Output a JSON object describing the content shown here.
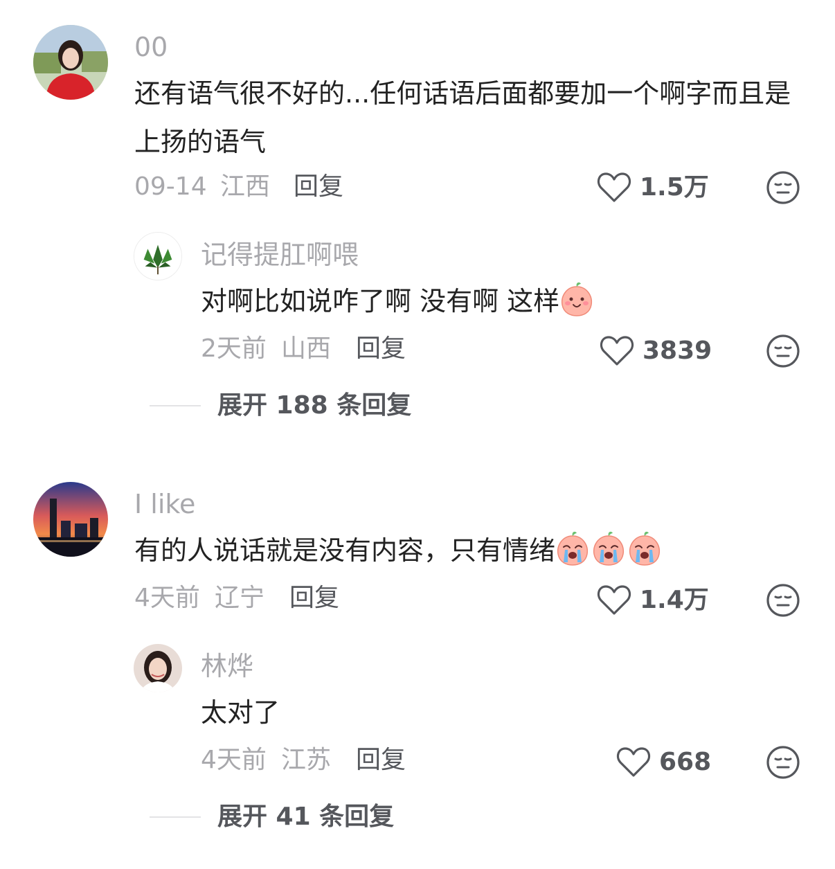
{
  "comments": [
    {
      "username": "00",
      "content": "还有语气很不好的...任何话语后面都要加一个啊字而且是上扬的语气",
      "time": "09-14",
      "location": "江西",
      "reply_label": "回复",
      "likes": "1.5万",
      "reply": {
        "username": "记得提肛啊喂",
        "content": "对啊比如说咋了啊 没有啊 这样",
        "time": "2天前",
        "location": "山西",
        "reply_label": "回复",
        "likes": "3839"
      },
      "expand_label": "展开 188 条回复"
    },
    {
      "username": "I like",
      "content": "有的人说话就是没有内容，只有情绪",
      "time": "4天前",
      "location": "辽宁",
      "reply_label": "回复",
      "likes": "1.4万",
      "reply": {
        "username": "林烨",
        "content": "太对了",
        "time": "4天前",
        "location": "江苏",
        "reply_label": "回复",
        "likes": "668"
      },
      "expand_label": "展开 41 条回复"
    }
  ],
  "icons": {
    "like": "heart-outline-icon",
    "dislike": "meh-face-icon",
    "emoji_smile": "peach-smile-emoji",
    "emoji_cry": "peach-cry-emoji"
  },
  "colors": {
    "text_primary": "#222222",
    "text_secondary": "#a8a8ac",
    "text_action": "#55575c",
    "divider": "#e3e3e5"
  }
}
